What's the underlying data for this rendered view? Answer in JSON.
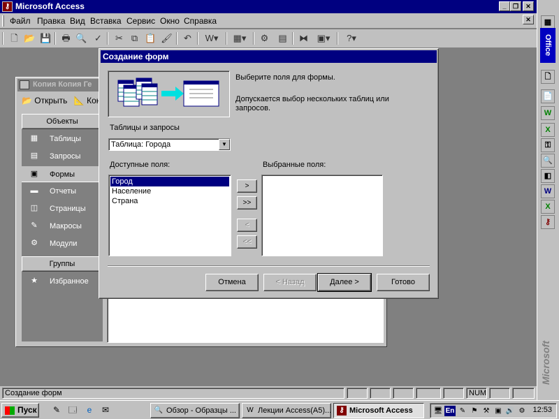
{
  "app": {
    "title": "Microsoft Access"
  },
  "menu": [
    "Файл",
    "Правка",
    "Вид",
    "Вставка",
    "Сервис",
    "Окно",
    "Справка"
  ],
  "toolbar_icons": [
    "new-icon",
    "open-icon",
    "save-icon",
    "print-icon",
    "print-preview-icon",
    "spelling-icon",
    "cut-icon",
    "copy-icon",
    "paste-icon",
    "format-painter-icon",
    "undo-icon",
    "office-links-icon",
    "analyze-icon",
    "code-icon",
    "properties-icon",
    "relationships-icon",
    "new-object-icon",
    "help-icon"
  ],
  "office_bar": {
    "label": "Office",
    "brand": "Microsoft"
  },
  "db_window": {
    "title": "Копия Копия Ге",
    "open_label": "Открыть",
    "design_label": "Кон",
    "objects_header": "Объекты",
    "objects": [
      {
        "label": "Таблицы",
        "icon": "table-icon"
      },
      {
        "label": "Запросы",
        "icon": "query-icon"
      },
      {
        "label": "Формы",
        "icon": "form-icon"
      },
      {
        "label": "Отчеты",
        "icon": "report-icon"
      },
      {
        "label": "Страницы",
        "icon": "page-icon"
      },
      {
        "label": "Макросы",
        "icon": "macro-icon"
      },
      {
        "label": "Модули",
        "icon": "module-icon"
      }
    ],
    "groups_header": "Группы",
    "groups": [
      {
        "label": "Избранное",
        "icon": "favorites-icon"
      }
    ]
  },
  "dialog": {
    "title": "Создание форм",
    "instruction": "Выберите поля для формы.",
    "hint_line1": "Допускается выбор нескольких таблиц или",
    "hint_line2": "запросов.",
    "tables_label": "Таблицы и запросы",
    "table_value": "Таблица: Города",
    "available_label": "Доступные поля:",
    "selected_label": "Выбранные поля:",
    "available_fields": [
      "Город",
      "Население",
      "Страна"
    ],
    "selected_field_index": 0,
    "selected_fields": [],
    "move_one": ">",
    "move_all": ">>",
    "remove_one": "<",
    "remove_all": "<<",
    "cancel": "Отмена",
    "back": "< Назад",
    "next": "Далее >",
    "finish": "Готово"
  },
  "status": {
    "text": "Создание форм",
    "num": "NUM"
  },
  "taskbar": {
    "start": "Пуск",
    "tasks": [
      {
        "label": "Обзор - Образцы ...",
        "active": false
      },
      {
        "label": "Лекции Access(A5)...",
        "active": false
      },
      {
        "label": "Microsoft Access",
        "active": true
      }
    ],
    "lang": "En",
    "clock": "12:53"
  },
  "colors": {
    "title_active": "#000080",
    "face": "#c0c0c0",
    "desktop": "#808080"
  }
}
